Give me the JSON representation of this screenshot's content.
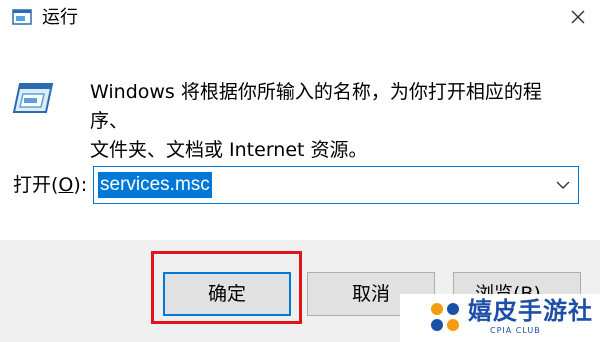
{
  "window": {
    "title": "运行",
    "close_glyph": "✕"
  },
  "description": {
    "line1": "Windows 将根据你所输入的名称，为你打开相应的程序、",
    "line2": "文件夹、文档或 Internet 资源。"
  },
  "open": {
    "label_prefix": "打开(",
    "label_accel": "O",
    "label_suffix": "):",
    "value": "services.msc"
  },
  "buttons": {
    "ok": "确定",
    "cancel": "取消",
    "browse": "浏览(B)..."
  },
  "logo": {
    "name": "嬉皮手游社",
    "sub": "CPIA CLUB"
  },
  "colors": {
    "accent": "#0078d7",
    "highlight": "#e2141b",
    "logo": "#1e4fa8"
  },
  "icons": {
    "title": "run-app-icon",
    "run": "run-dialog-icon",
    "close": "close-icon",
    "dropdown": "chevron-down-icon",
    "logo": "pinwheel-logo-icon"
  }
}
